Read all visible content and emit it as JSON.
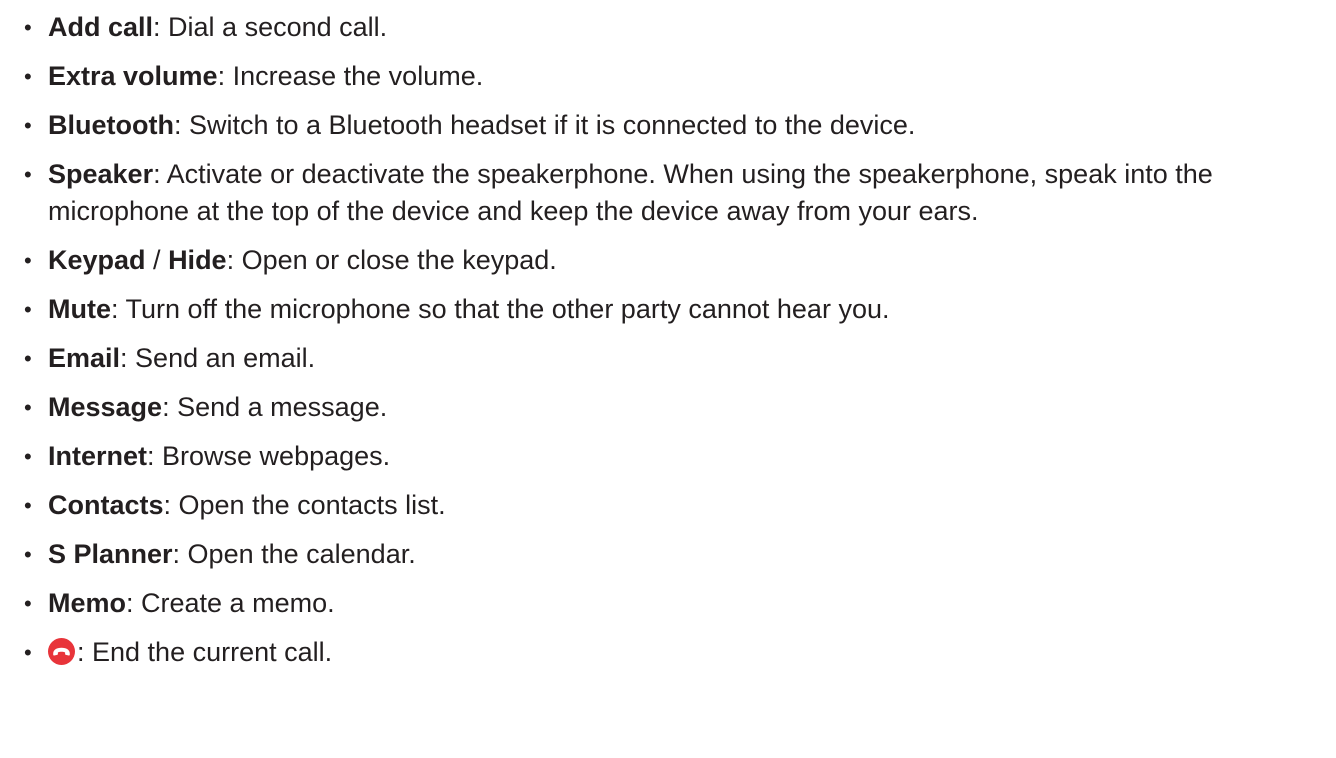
{
  "items": [
    {
      "term": "Add call",
      "desc": ": Dial a second call."
    },
    {
      "term": "Extra volume",
      "desc": ": Increase the volume."
    },
    {
      "term": "Bluetooth",
      "desc": ": Switch to a Bluetooth headset if it is connected to the device."
    },
    {
      "term": "Speaker",
      "desc": ": Activate or deactivate the speakerphone. When using the speakerphone, speak into the microphone at the top of the device and keep the device away from your ears."
    },
    {
      "term": "Keypad",
      "sep": " / ",
      "term2": "Hide",
      "desc": ": Open or close the keypad."
    },
    {
      "term": "Mute",
      "desc": ": Turn off the microphone so that the other party cannot hear you."
    },
    {
      "term": "Email",
      "desc": ": Send an email."
    },
    {
      "term": "Message",
      "desc": ": Send a message."
    },
    {
      "term": "Internet",
      "desc": ": Browse webpages."
    },
    {
      "term": "Contacts",
      "desc": ": Open the contacts list."
    },
    {
      "term": "S Planner",
      "desc": ": Open the calendar."
    },
    {
      "term": "Memo",
      "desc": ": Create a memo."
    },
    {
      "icon": "end-call-icon",
      "desc": ": End the current call."
    }
  ],
  "bullet": "•",
  "colors": {
    "text": "#231f20",
    "end_call_red": "#e8343a"
  }
}
